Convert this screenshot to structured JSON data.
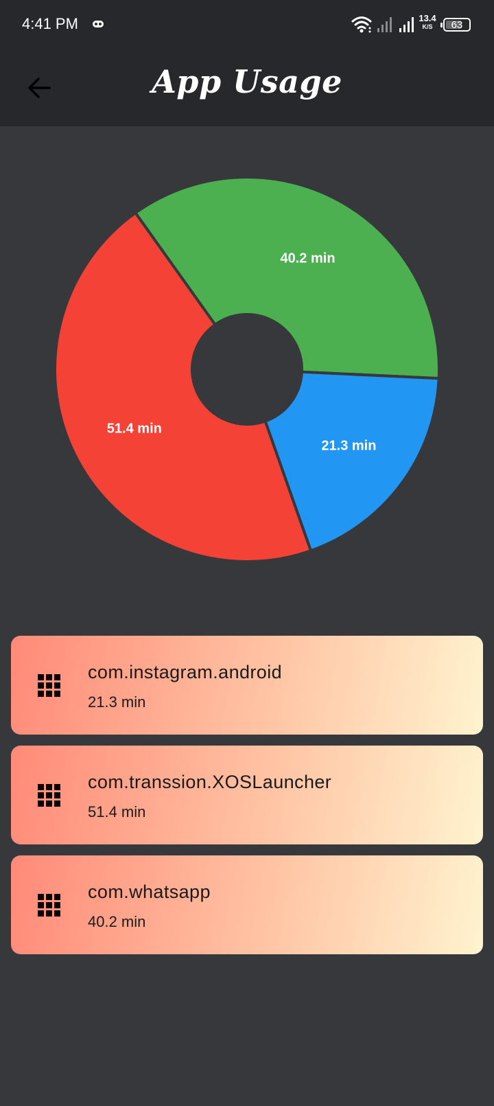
{
  "status_bar": {
    "time": "4:41 PM",
    "net_speed_value": "13.4",
    "net_speed_unit": "K/S",
    "battery": "63"
  },
  "app_bar": {
    "title": "App Usage",
    "back_icon": "arrow-left-icon"
  },
  "chart_data": {
    "type": "pie",
    "style": "donut",
    "slices": [
      {
        "label": "40.2 min",
        "value": 40.2,
        "color": "#4caf50"
      },
      {
        "label": "21.3 min",
        "value": 21.3,
        "color": "#2196f3"
      },
      {
        "label": "51.4 min",
        "value": 51.4,
        "color": "#f44336"
      }
    ],
    "start": "left-top",
    "separator_color": "#37383b"
  },
  "usage_list": [
    {
      "app": "com.instagram.android",
      "duration": "21.3 min",
      "icon": "apps-grid-icon"
    },
    {
      "app": "com.transsion.XOSLauncher",
      "duration": "51.4 min",
      "icon": "apps-grid-icon"
    },
    {
      "app": "com.whatsapp",
      "duration": "40.2 min",
      "icon": "apps-grid-icon"
    }
  ],
  "colors": {
    "background": "#37383b",
    "app_bar": "#27282c",
    "card_gradient_start": "#ff8a78",
    "card_gradient_end": "#fff3cf"
  }
}
